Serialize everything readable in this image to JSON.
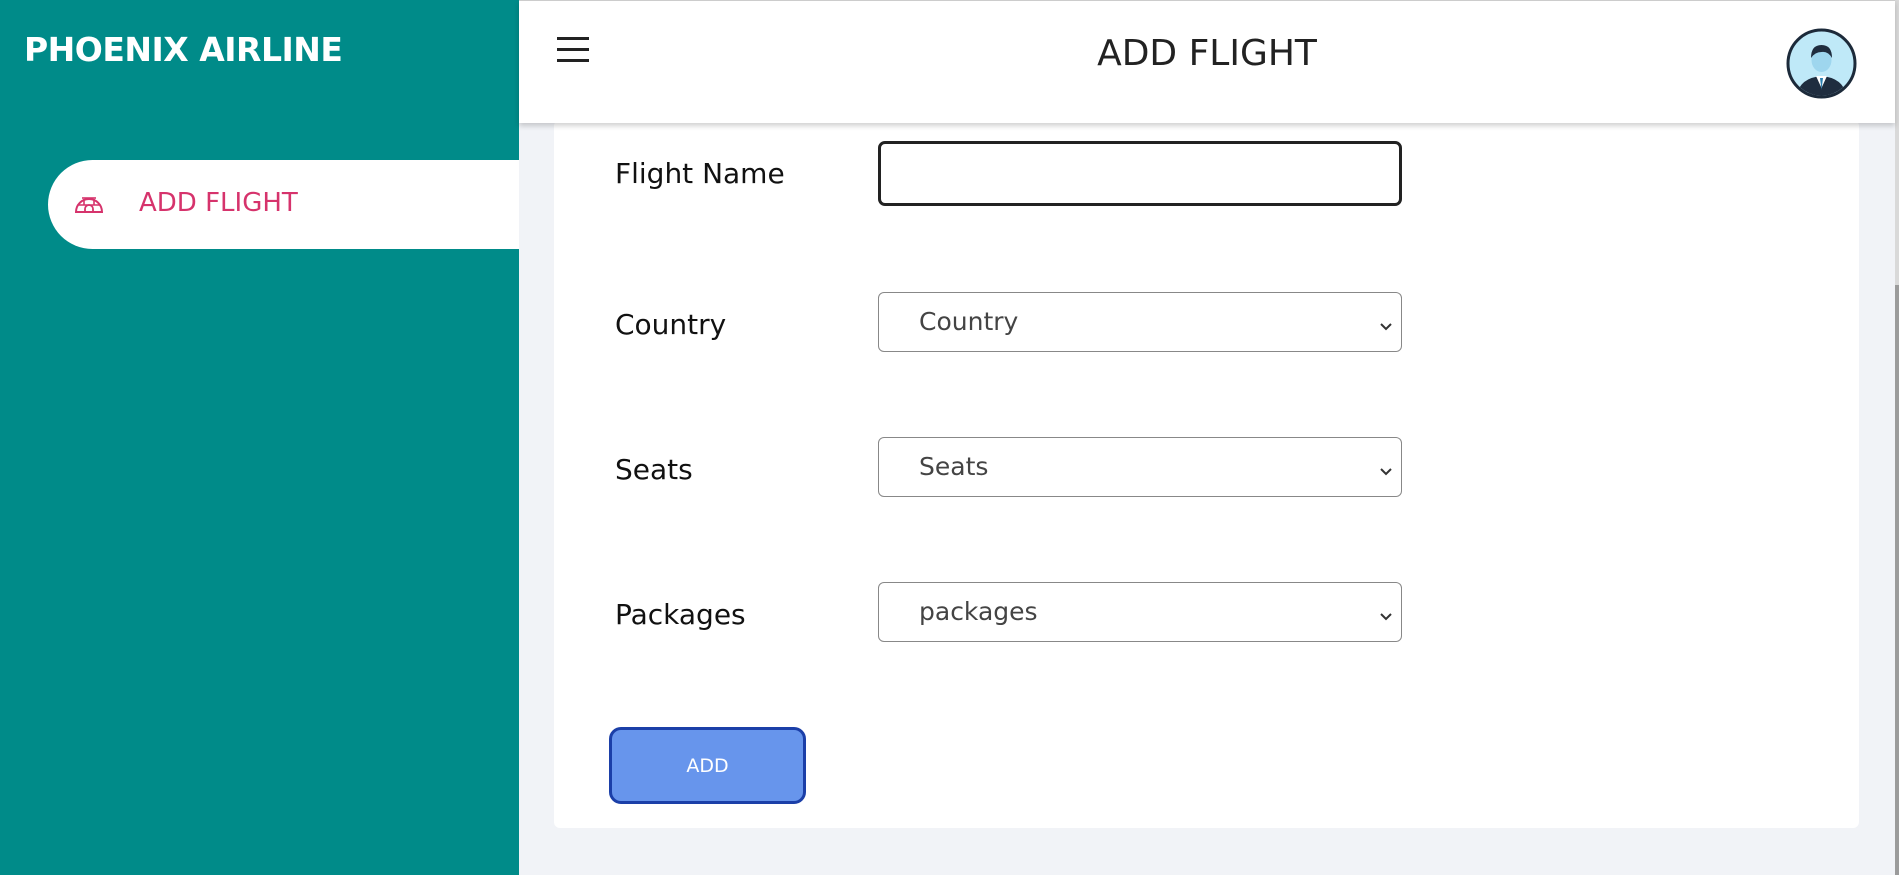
{
  "sidebar": {
    "brand": "PHOENIX AIRLINE",
    "items": [
      {
        "label": "ADD FLIGHT",
        "icon": "igloo-icon",
        "active": true
      }
    ]
  },
  "header": {
    "title": "ADD FLIGHT",
    "menu_icon": "hamburger-menu-icon",
    "avatar": "user-avatar-icon"
  },
  "form": {
    "flight_name": {
      "label": "Flight Name",
      "value": ""
    },
    "country": {
      "label": "Country",
      "selected": "Country"
    },
    "seats": {
      "label": "Seats",
      "selected": "Seats"
    },
    "packages": {
      "label": "Packages",
      "selected": "packages"
    },
    "submit_label": "ADD"
  },
  "colors": {
    "sidebar_bg": "#008b89",
    "active_label": "#d6336c",
    "button_bg": "#6795ec",
    "button_border": "#1b3fa8",
    "page_bg": "#f1f3f7"
  }
}
